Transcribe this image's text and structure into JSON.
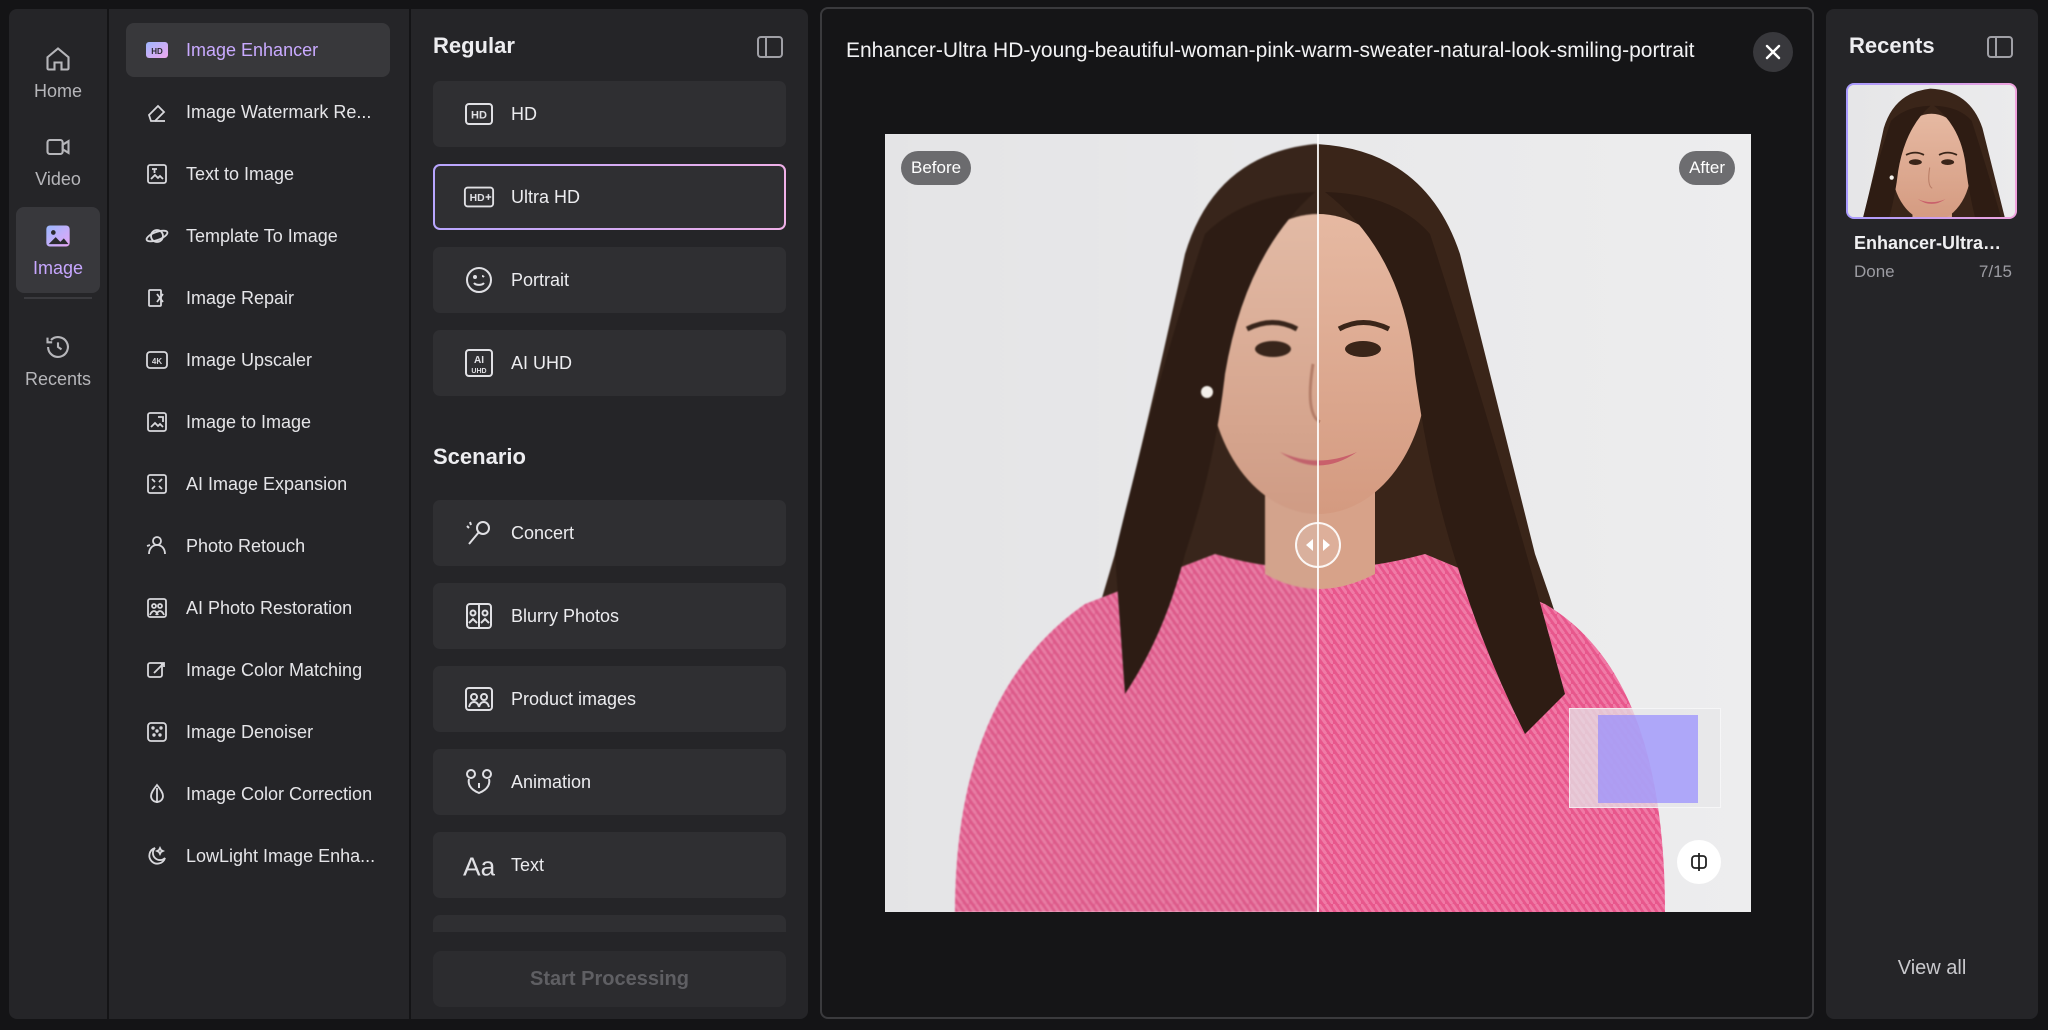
{
  "nav": {
    "items": [
      {
        "label": "Home",
        "icon": "home-icon"
      },
      {
        "label": "Video",
        "icon": "video-icon"
      },
      {
        "label": "Image",
        "icon": "image-icon",
        "active": true
      },
      {
        "label": "Recents",
        "icon": "history-icon"
      }
    ]
  },
  "tools": {
    "items": [
      {
        "label": "Image Enhancer",
        "icon": "hd-badge-icon",
        "active": true
      },
      {
        "label": "Image Watermark Re...",
        "icon": "eraser-icon"
      },
      {
        "label": "Text to Image",
        "icon": "text-image-icon"
      },
      {
        "label": "Template To Image",
        "icon": "template-icon"
      },
      {
        "label": "Image Repair",
        "icon": "repair-icon"
      },
      {
        "label": "Image Upscaler",
        "icon": "4k-icon"
      },
      {
        "label": "Image to Image",
        "icon": "image-to-image-icon"
      },
      {
        "label": "AI Image Expansion",
        "icon": "expand-icon"
      },
      {
        "label": "Photo Retouch",
        "icon": "retouch-icon"
      },
      {
        "label": "AI Photo Restoration",
        "icon": "restoration-icon"
      },
      {
        "label": "Image Color Matching",
        "icon": "color-match-icon"
      },
      {
        "label": "Image Denoiser",
        "icon": "denoise-icon"
      },
      {
        "label": "Image Color Correction",
        "icon": "color-correction-icon"
      },
      {
        "label": "LowLight Image Enha...",
        "icon": "moon-icon"
      }
    ]
  },
  "options": {
    "regular_heading": "Regular",
    "regular": [
      {
        "label": "HD",
        "icon": "hd-icon"
      },
      {
        "label": "Ultra HD",
        "icon": "hd-plus-icon",
        "selected": true
      },
      {
        "label": "Portrait",
        "icon": "portrait-icon"
      },
      {
        "label": "AI UHD",
        "icon": "ai-uhd-icon"
      }
    ],
    "scenario_heading": "Scenario",
    "scenario": [
      {
        "label": "Concert",
        "icon": "microphone-icon"
      },
      {
        "label": "Blurry Photos",
        "icon": "blurry-photo-icon"
      },
      {
        "label": "Product images",
        "icon": "product-icon"
      },
      {
        "label": "Animation",
        "icon": "animation-icon"
      },
      {
        "label": "Text",
        "icon": "text-aa-icon"
      }
    ],
    "start_label": "Start Processing"
  },
  "preview": {
    "title": "Enhancer-Ultra HD-young-beautiful-woman-pink-warm-sweater-natural-look-smiling-portrait",
    "before_label": "Before",
    "after_label": "After",
    "split_fraction": 0.5
  },
  "recents": {
    "title": "Recents",
    "items": [
      {
        "name": "Enhancer-Ultra HD-young-beautiful-woman",
        "status": "Done",
        "count": "7/15"
      }
    ],
    "view_all": "View all"
  },
  "colors": {
    "accent": "#c7a7ff",
    "background": "#141416",
    "panel": "#252528",
    "card": "#2f2f32"
  }
}
